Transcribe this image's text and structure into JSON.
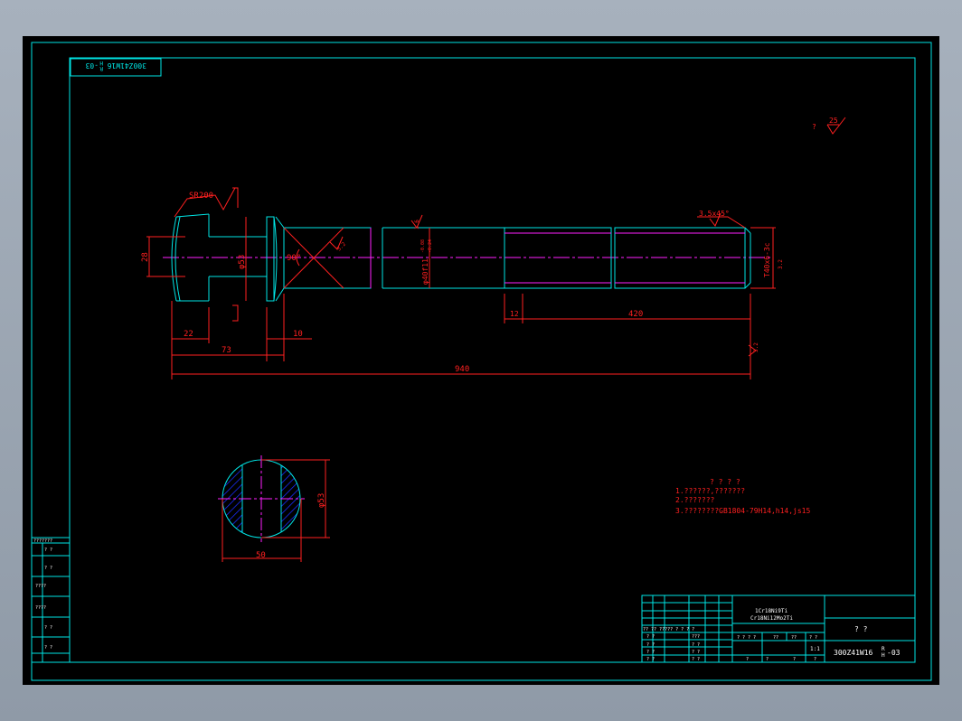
{
  "colors": {
    "frame": "#00e5e5",
    "dim": "#ff2020",
    "center": "#ff20ff",
    "white": "#ffffff",
    "hatch": "#1a2dff",
    "background": "#000000"
  },
  "drawing_number": "300Z41W16 ",
  "drawing_number_sub_top": "R",
  "drawing_number_sub_bottom": "H",
  "drawing_number_suffix": "-03",
  "stamp_rotated": "300Z41W16",
  "stamp_rotated_sup": "R",
  "stamp_rotated_sub": "H",
  "stamp_rotated_suffix": "-03",
  "roughness_note": {
    "prefix": "?",
    "value": "25"
  },
  "dims": {
    "sr": "SR200",
    "d28": "28",
    "d53": "φ53",
    "angle": "90°",
    "rough_32_a": "3.2",
    "rough_32_b": "1.6",
    "rough_32_c": "3.2",
    "rough_32_d": "3.2",
    "shaft_dia": "φ40f11",
    "shaft_tol_top": "-0.08",
    "shaft_tol_bot": "-0.24",
    "chamfer": "3.5x45°",
    "thread": "T40x6-3c",
    "d22": "22",
    "d10": "10",
    "d73": "73",
    "d940": "940",
    "d12": "12",
    "d420": "420",
    "sec_d53": "φ53",
    "sec_50": "50"
  },
  "notes": {
    "heading": "? ? ? ?",
    "line1": "1.??????,???????",
    "line2": "2.???????",
    "line3": "3.????????GB1804-79H14,h14,js15"
  },
  "title_block": {
    "material1": "1Cr18Ni9Ti",
    "material2": "Cr18Ni12Mo2Ti",
    "part_name": "?  ?",
    "scale": "1:1",
    "rows_a": [
      "?? ?? ????? ? ? ? ?",
      "? ?",
      "? ?",
      "? ?"
    ],
    "row_labels_left": [
      "? ?",
      "? ?",
      "? ?"
    ],
    "row_labels_mid": [
      "???",
      "? ?",
      "? ?",
      "? ?"
    ],
    "row_stage": [
      "? ? ? ?",
      "??",
      "??",
      "? ?"
    ],
    "row_bottom": [
      "?",
      "?",
      "?",
      "?"
    ]
  },
  "side_block": {
    "rows": [
      "???????",
      "? ?",
      "? ?",
      "????",
      "????",
      "? ?",
      "? ?"
    ]
  }
}
